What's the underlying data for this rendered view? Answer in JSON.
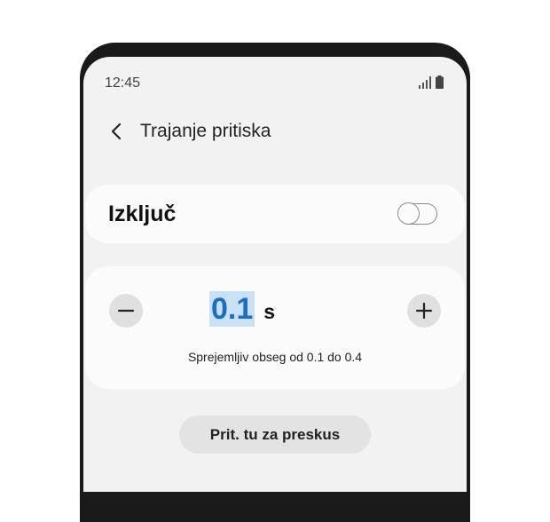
{
  "status_bar": {
    "time": "12:45",
    "icons": [
      "signal-icon",
      "battery-icon"
    ]
  },
  "header": {
    "back_icon": "chevron-left-icon",
    "title": "Trajanje pritiska"
  },
  "toggle_card": {
    "label": "Izključ",
    "toggle_on": false
  },
  "value_card": {
    "minus_icon": "minus-icon",
    "value": "0.1",
    "unit": "s",
    "plus_icon": "plus-icon",
    "range_text": "Sprejemljiv obseg od 0.1 do 0.4"
  },
  "skip_button": {
    "label": "Prit. tu za preskus"
  },
  "colors": {
    "accent": "#1a6fc4",
    "selection_highlight": "#c9e0f7",
    "background": "#f2f2f2",
    "card": "#fbfbfb"
  }
}
